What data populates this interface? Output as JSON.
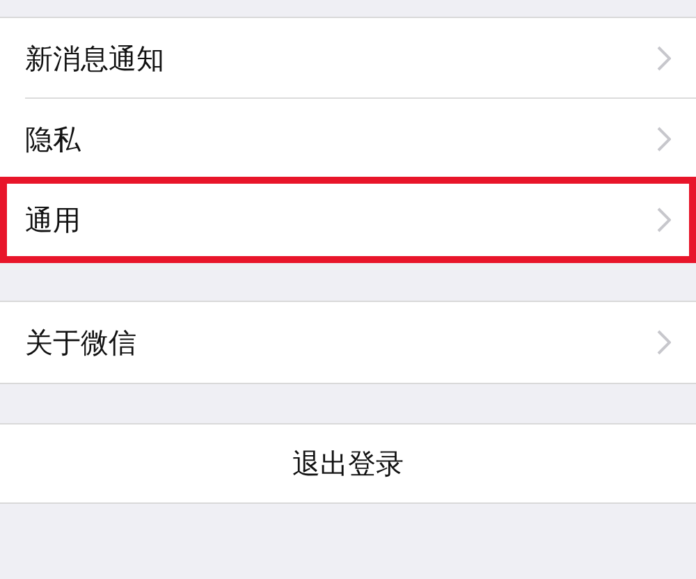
{
  "settings_groups": [
    {
      "items": [
        {
          "label": "新消息通知",
          "highlighted": false
        },
        {
          "label": "隐私",
          "highlighted": false
        },
        {
          "label": "通用",
          "highlighted": true
        }
      ]
    },
    {
      "items": [
        {
          "label": "关于微信",
          "highlighted": false
        }
      ]
    }
  ],
  "logout_button": {
    "label": "退出登录"
  }
}
